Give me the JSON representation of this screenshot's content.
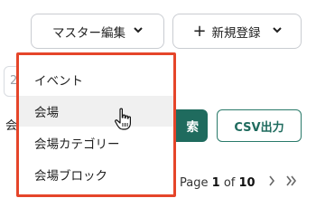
{
  "toolbar": {
    "master_edit_label": "マスター編集",
    "new_register_label": "新規登録",
    "chevron": "▾",
    "plus": "+"
  },
  "background": {
    "input_fragment": "2",
    "label_fragment": "会",
    "search_label": "検索",
    "search_visible": "索",
    "csv_label": "CSV出力"
  },
  "pagination": {
    "page_word": "Page",
    "current": "1",
    "of_word": "of",
    "total": "10",
    "next_glyph": "›",
    "last_glyph": "»"
  },
  "dropdown": {
    "items": [
      {
        "label": "イベント"
      },
      {
        "label": "会場"
      },
      {
        "label": "会場カテゴリー"
      },
      {
        "label": "会場ブロック"
      }
    ],
    "highlight_color": "#e5452a"
  },
  "colors": {
    "primary": "#1f6b5e",
    "border": "#c9ccd1"
  }
}
